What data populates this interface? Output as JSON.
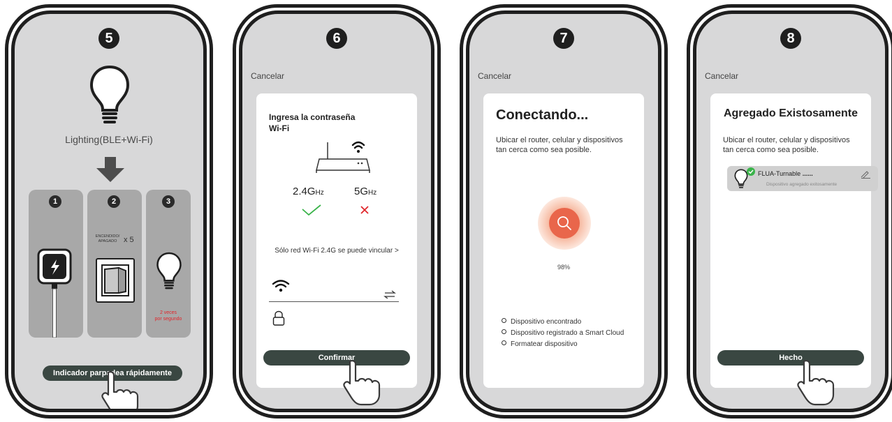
{
  "screens": [
    {
      "step": "5",
      "device_label": "Lighting(BLE+Wi-Fi)",
      "panels": [
        {
          "number": "1"
        },
        {
          "number": "2",
          "switch_text_1": "ENCENDIDO/",
          "switch_text_2": "APAGADO",
          "times": "x 5"
        },
        {
          "number": "3",
          "note_1": "2 veces",
          "note_2": "por segundo"
        }
      ],
      "button": "Indicador parpadea rápidamente"
    },
    {
      "step": "6",
      "cancel": "Cancelar",
      "title_line1": "Ingresa la contraseña",
      "title_line2": "Wi-Fi",
      "band_24": "2.4G",
      "band_24_unit": "Hz",
      "band_5": "5G",
      "band_5_unit": "Hz",
      "link": "Sólo red Wi-Fi 2.4G se puede vincular >",
      "button": "Confirmar"
    },
    {
      "step": "7",
      "cancel": "Cancelar",
      "title": "Conectando...",
      "desc_line1": "Ubicar el router, celular y dispositivos",
      "desc_line2": "tan cerca como sea posible.",
      "progress": "98%",
      "progress_value": 98,
      "status_items": [
        "Dispositivo encontrado",
        "Dispositivo registrado a Smart Cloud",
        "Formatear dispositivo"
      ]
    },
    {
      "step": "8",
      "cancel": "Cancelar",
      "title": "Agregado Existosamente",
      "desc_line1": "Ubicar el router, celular y dispositivos",
      "desc_line2": "tan cerca como sea posible.",
      "device_name": "FLUA-Turnable",
      "device_suffix": "......",
      "device_status": "Dispositivo agregado exitosamente",
      "button": "Hecho"
    }
  ],
  "colors": {
    "frame": "#1f1f1f",
    "screen_bg": "#d8d8d9",
    "button_bg": "#3a4742",
    "check_green": "#3ab34a",
    "cross_red": "#e0262b",
    "accent_orange": "#e9664b",
    "note_red": "#e0262b"
  },
  "icons": [
    "bulb-icon",
    "arrow-down-icon",
    "plug-icon",
    "wall-switch-icon",
    "router-icon",
    "wifi-icon",
    "check-icon",
    "cross-icon",
    "lock-icon",
    "switch-network-icon",
    "search-icon",
    "edit-icon",
    "hand-pointer-icon"
  ]
}
